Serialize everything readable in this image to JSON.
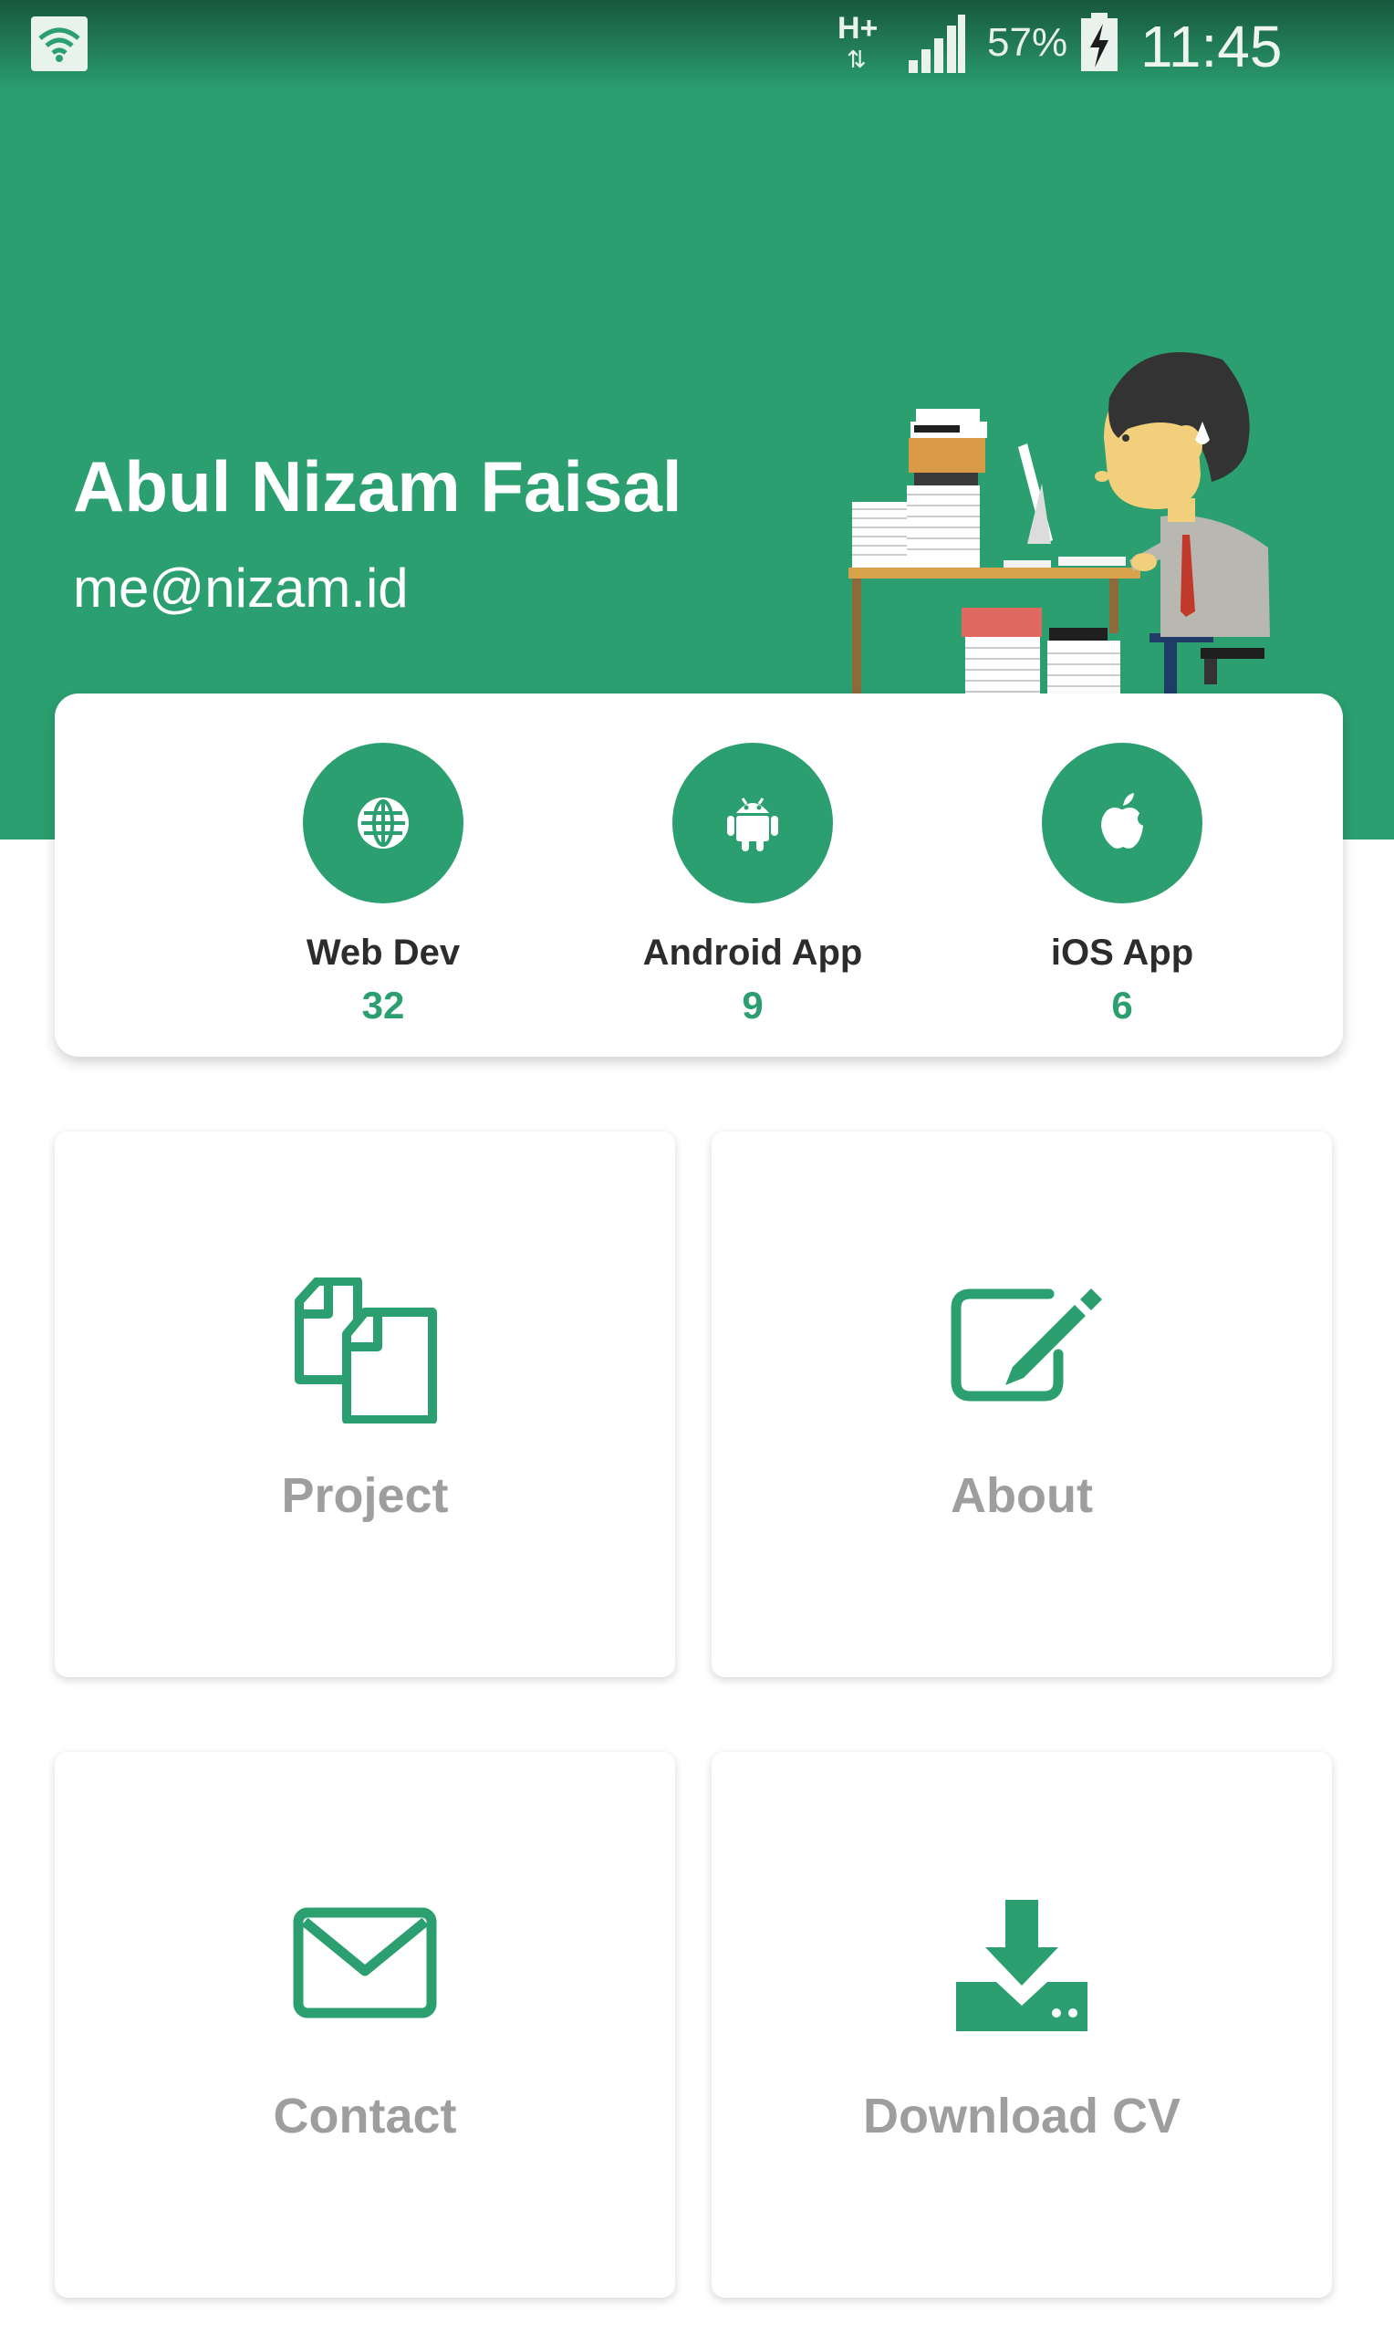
{
  "status_bar": {
    "network_type": "H+",
    "network_arrows": "⇅",
    "battery_percent": "57%",
    "time": "11:45",
    "icons": [
      "notification-icon",
      "signal-icon",
      "battery-charging-icon"
    ]
  },
  "profile": {
    "name": "Abul Nizam Faisal",
    "email": "me@nizam.id"
  },
  "stats": [
    {
      "label": "Web Dev",
      "count": "32",
      "icon": "globe-icon"
    },
    {
      "label": "Android App",
      "count": "9",
      "icon": "android-icon"
    },
    {
      "label": "iOS App",
      "count": "6",
      "icon": "apple-icon"
    }
  ],
  "menu": [
    {
      "label": "Project",
      "icon": "documents-icon"
    },
    {
      "label": "About",
      "icon": "edit-icon"
    },
    {
      "label": "Contact",
      "icon": "mail-icon"
    },
    {
      "label": "Download CV",
      "icon": "download-icon"
    }
  ],
  "colors": {
    "primary": "#2b9f6f",
    "card_background": "#ffffff",
    "menu_label": "#9e9e9e",
    "stat_label": "#2c2c2c"
  }
}
